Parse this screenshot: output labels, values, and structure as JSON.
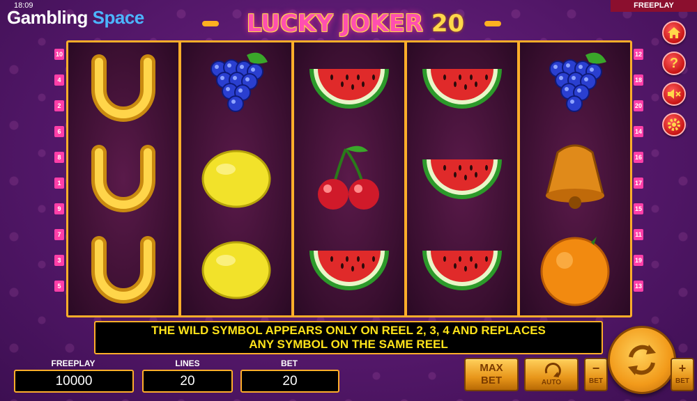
{
  "status": {
    "time": "18:09"
  },
  "brand": {
    "part1": "Gambling",
    "part2": "Space"
  },
  "game": {
    "title_main": "LUCKY JOKER",
    "title_num": "20"
  },
  "mode_tag": "FREEPLAY",
  "lines_left": [
    "10",
    "4",
    "2",
    "6",
    "8",
    "1",
    "9",
    "7",
    "3",
    "5"
  ],
  "lines_right": [
    "12",
    "18",
    "20",
    "14",
    "16",
    "17",
    "15",
    "11",
    "19",
    "13"
  ],
  "reels": [
    [
      "horseshoe-icon",
      "horseshoe-icon",
      "horseshoe-icon"
    ],
    [
      "grapes-icon",
      "lemon-icon",
      "lemon-icon"
    ],
    [
      "watermelon-icon",
      "cherries-icon",
      "watermelon-icon"
    ],
    [
      "watermelon-icon",
      "watermelon-icon",
      "watermelon-icon"
    ],
    [
      "grapes-icon",
      "bell-icon",
      "orange-icon"
    ]
  ],
  "info": {
    "line1": "THE WILD SYMBOL APPEARS ONLY ON REEL 2, 3, 4 AND REPLACES",
    "line2": "ANY SYMBOL ON THE SAME REEL"
  },
  "stats": {
    "freeplay_label": "FREEPLAY",
    "freeplay_value": "10000",
    "lines_label": "LINES",
    "lines_value": "20",
    "bet_label": "BET",
    "bet_value": "20"
  },
  "buttons": {
    "max_bet_1": "MAX",
    "max_bet_2": "BET",
    "auto": "AUTO",
    "bet_minus_sign": "−",
    "bet_minus": "BET",
    "bet_plus_sign": "+",
    "bet_plus": "BET"
  },
  "side_icons": [
    "home-icon",
    "help-icon",
    "sound-off-icon",
    "settings-icon"
  ],
  "side_glyphs": {
    "help": "?"
  },
  "colors": {
    "accent": "#ffae2a",
    "info_text": "#ffe31a",
    "line_badge": "#ff3fa8",
    "side_btn": "#c81414"
  }
}
